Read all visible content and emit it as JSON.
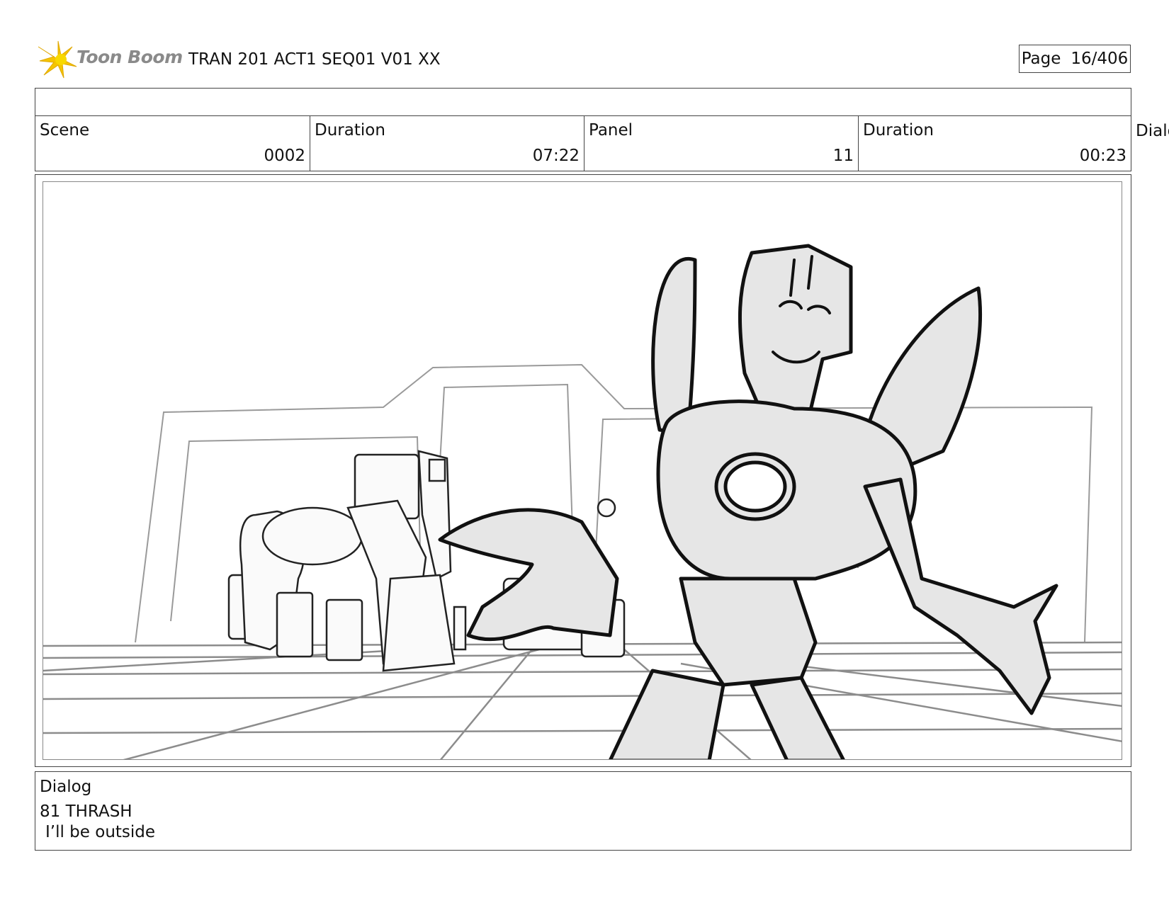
{
  "header": {
    "logo_text": "Toon Boom",
    "project_title": "TRAN 201 ACT1 SEQ01 V01 XX",
    "page_label": "Page",
    "page_value": "16/406"
  },
  "info": {
    "scene_label": "Scene",
    "scene_value": "0002",
    "scene_duration_label": "Duration",
    "scene_duration_value": "07:22",
    "panel_label": "Panel",
    "panel_value": "11",
    "panel_duration_label": "Duration",
    "panel_duration_value": "00:23",
    "overflow_label": "Dialo"
  },
  "dialog": {
    "label": "Dialog",
    "line1": "81 THRASH",
    "line2": "I’ll be outside"
  },
  "colors": {
    "sketch_fill": "#e6e6e6",
    "line": "#111111",
    "grid": "#8c8c8c",
    "logo_accent": "#f5c400"
  }
}
